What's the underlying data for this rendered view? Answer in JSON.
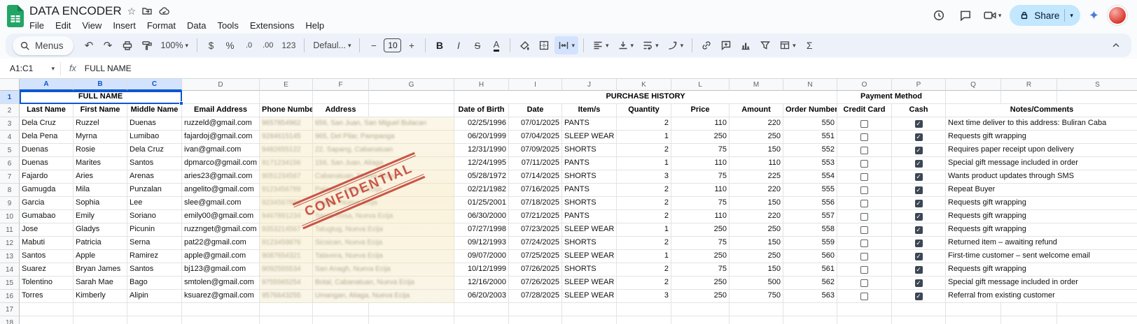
{
  "app": {
    "doc_title": "DATA ENCODER",
    "menus": [
      "File",
      "Edit",
      "View",
      "Insert",
      "Format",
      "Data",
      "Tools",
      "Extensions",
      "Help"
    ],
    "share_label": "Share"
  },
  "toolbar": {
    "menus_label": "Menus",
    "zoom": "100%",
    "currency": "$",
    "percent": "%",
    "decrease_decimal": ".0",
    "increase_decimal": ".00",
    "more_formats": "123",
    "font_name": "Defaul...",
    "minus": "−",
    "font_size": "10",
    "plus": "+",
    "bold": "B",
    "italic": "I",
    "strikethrough": "S",
    "text_color": "A",
    "functions": "Σ"
  },
  "formula_bar": {
    "cell_ref": "A1:C1",
    "fx": "fx",
    "value": "FULL NAME"
  },
  "colors": {
    "accent_blue": "#0b57d0",
    "selected_header": "#d3e3fd",
    "share_pill": "#c2e7ff",
    "toolbar_bg": "#edf2fa",
    "stamp_red": "#c13a2e",
    "checkbox_checked": "#3b4752",
    "logo_green": "#23a566"
  },
  "sheet": {
    "columns": [
      "A",
      "B",
      "C",
      "D",
      "E",
      "F",
      "G",
      "H",
      "I",
      "J",
      "K",
      "L",
      "M",
      "N",
      "O",
      "P",
      "Q",
      "R",
      "S"
    ],
    "group_headers": {
      "full_name": "FULL NAME",
      "purchase_history": "PURCHASE HISTORY",
      "payment_method": "Payment Method"
    },
    "column_headers": {
      "last_name": "Last Name",
      "first_name": "First Name",
      "middle_name": "Middle Name",
      "email": "Email Address",
      "phone": "Phone Number",
      "address": "Address",
      "dob": "Date of Birth",
      "date": "Date",
      "items": "Item/s",
      "quantity": "Quantity",
      "price": "Price",
      "amount": "Amount",
      "order_number": "Order Number",
      "credit_card": "Credit Card",
      "cash": "Cash",
      "notes": "Notes/Comments"
    },
    "stamp_text": "CONFIDENTIAL",
    "rows": [
      {
        "last": "Dela Cruz",
        "first": "Ruzzel",
        "middle": "Duenas",
        "email": "ruzzeld@gmail.com",
        "phone": "9657854962",
        "address": "656, San Juan, San Miguel Bulacan",
        "dob": "02/25/1996",
        "date": "07/01/2025",
        "item": "PANTS",
        "qty": "2",
        "price": "110",
        "amount": "220",
        "order": "550",
        "credit": false,
        "cash": true,
        "notes": "Next time deliver to this address: Buliran Caba"
      },
      {
        "last": "Dela Pena",
        "first": "Myrna",
        "middle": "Lumibao",
        "email": "fajardoj@gmail.com",
        "phone": "9284615145",
        "address": "965, Del Pilar, Pampanga",
        "dob": "06/20/1999",
        "date": "07/04/2025",
        "item": "SLEEP WEAR",
        "qty": "1",
        "price": "250",
        "amount": "250",
        "order": "551",
        "credit": false,
        "cash": true,
        "notes": "Requests gift wrapping"
      },
      {
        "last": "Duenas",
        "first": "Rosie",
        "middle": "Dela Cruz",
        "email": "ivan@gmail.com",
        "phone": "9482655122",
        "address": "22, Sapang, Cabanatuan",
        "dob": "12/31/1990",
        "date": "07/09/2025",
        "item": "SHORTS",
        "qty": "2",
        "price": "75",
        "amount": "150",
        "order": "552",
        "credit": false,
        "cash": true,
        "notes": "Requires paper receipt upon delivery"
      },
      {
        "last": "Duenas",
        "first": "Marites",
        "middle": "Santos",
        "email": "dpmarco@gmail.com",
        "phone": "9171234156",
        "address": "156, San Juan, Aliaga",
        "dob": "12/24/1995",
        "date": "07/11/2025",
        "item": "PANTS",
        "qty": "1",
        "price": "110",
        "amount": "110",
        "order": "553",
        "credit": false,
        "cash": true,
        "notes": "Special gift message included in order"
      },
      {
        "last": "Fajardo",
        "first": "Aries",
        "middle": "Arenas",
        "email": "aries23@gmail.com",
        "phone": "9051234567",
        "address": "Cabanatuan, Nueva Ecija",
        "dob": "05/28/1972",
        "date": "07/14/2025",
        "item": "SHORTS",
        "qty": "3",
        "price": "75",
        "amount": "225",
        "order": "554",
        "credit": false,
        "cash": true,
        "notes": "Wants product updates through SMS"
      },
      {
        "last": "Gamugda",
        "first": "Mila",
        "middle": "Punzalan",
        "email": "angelito@gmail.com",
        "phone": "9123456789",
        "address": "Palayan, Nueva Ecija",
        "dob": "02/21/1982",
        "date": "07/16/2025",
        "item": "PANTS",
        "qty": "2",
        "price": "110",
        "amount": "220",
        "order": "555",
        "credit": false,
        "cash": true,
        "notes": "Repeat Buyer"
      },
      {
        "last": "Garcia",
        "first": "Sophia",
        "middle": "Lee",
        "email": "slee@gmail.com",
        "phone": "9234567891",
        "address": "Gapan, Nueva Ecija",
        "dob": "01/25/2001",
        "date": "07/18/2025",
        "item": "SHORTS",
        "qty": "2",
        "price": "75",
        "amount": "150",
        "order": "556",
        "credit": false,
        "cash": true,
        "notes": "Requests gift wrapping"
      },
      {
        "last": "Gumabao",
        "first": "Emily",
        "middle": "Soriano",
        "email": "emily00@gmail.com",
        "phone": "9467891234",
        "address": "Santa Rosa, Nueva Ecija",
        "dob": "06/30/2000",
        "date": "07/21/2025",
        "item": "PANTS",
        "qty": "2",
        "price": "110",
        "amount": "220",
        "order": "557",
        "credit": false,
        "cash": true,
        "notes": "Requests gift wrapping"
      },
      {
        "last": "Jose",
        "first": "Gladys",
        "middle": "Picunin",
        "email": "ruzznget@gmail.com",
        "phone": "9353214567",
        "address": "Talugtug, Nueva Ecija",
        "dob": "07/27/1998",
        "date": "07/23/2025",
        "item": "SLEEP WEAR",
        "qty": "1",
        "price": "250",
        "amount": "250",
        "order": "558",
        "credit": false,
        "cash": true,
        "notes": "Requests gift wrapping"
      },
      {
        "last": "Mabuti",
        "first": "Patricia",
        "middle": "Serna",
        "email": "pat22@gmail.com",
        "phone": "9123459876",
        "address": "Sicsican, Nueva Ecija",
        "dob": "09/12/1993",
        "date": "07/24/2025",
        "item": "SHORTS",
        "qty": "2",
        "price": "75",
        "amount": "150",
        "order": "559",
        "credit": false,
        "cash": true,
        "notes": "Returned item – awaiting refund"
      },
      {
        "last": "Santos",
        "first": "Apple",
        "middle": "Ramirez",
        "email": "apple@gmail.com",
        "phone": "9087654321",
        "address": "Talavera, Nueva Ecija",
        "dob": "09/07/2000",
        "date": "07/25/2025",
        "item": "SLEEP WEAR",
        "qty": "1",
        "price": "250",
        "amount": "250",
        "order": "560",
        "credit": false,
        "cash": true,
        "notes": "First-time customer – sent welcome email"
      },
      {
        "last": "Suarez",
        "first": "Bryan James",
        "middle": "Santos",
        "email": "bj123@gmail.com",
        "phone": "9092555534",
        "address": "San Anagh, Nueva Ecija",
        "dob": "10/12/1999",
        "date": "07/26/2025",
        "item": "SHORTS",
        "qty": "2",
        "price": "75",
        "amount": "150",
        "order": "561",
        "credit": false,
        "cash": true,
        "notes": "Requests gift wrapping"
      },
      {
        "last": "Tolentino",
        "first": "Sarah Mae",
        "middle": "Bago",
        "email": "smtolen@gmail.com",
        "phone": "9755565254",
        "address": "Botal, Cabanatuan, Nueva Ecija",
        "dob": "12/16/2000",
        "date": "07/26/2025",
        "item": "SLEEP WEAR",
        "qty": "2",
        "price": "250",
        "amount": "500",
        "order": "562",
        "credit": false,
        "cash": true,
        "notes": "Special gift message included in order"
      },
      {
        "last": "Torres",
        "first": "Kimberly",
        "middle": "Alipin",
        "email": "ksuarez@gmail.com",
        "phone": "9576643255",
        "address": "Umangan, Aliaga, Nueva Ecija",
        "dob": "06/20/2003",
        "date": "07/28/2025",
        "item": "SLEEP WEAR",
        "qty": "3",
        "price": "250",
        "amount": "750",
        "order": "563",
        "credit": false,
        "cash": true,
        "notes": "Referral from existing customer"
      }
    ]
  }
}
